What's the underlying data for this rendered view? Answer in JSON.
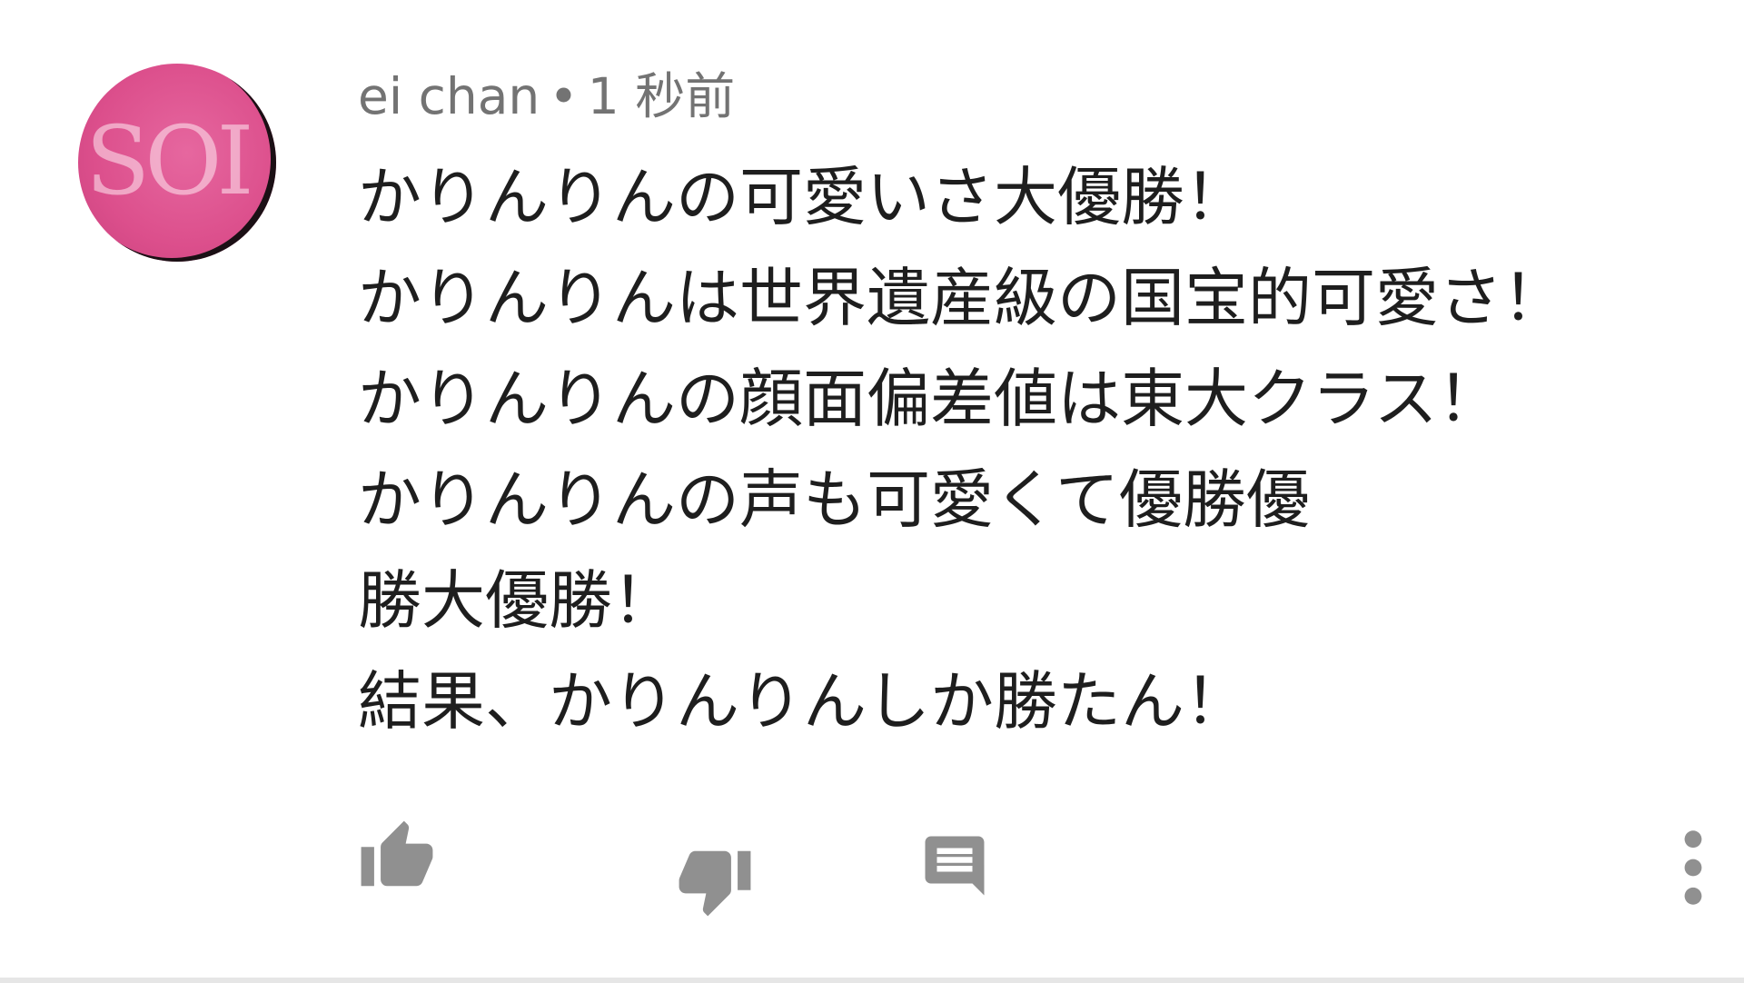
{
  "comment": {
    "author": "ei chan",
    "separator": "•",
    "time": "1 秒前",
    "avatar_text": "SOI",
    "lines": [
      "かりんりんの可愛いさ大優勝！",
      "かりんりんは世界遺産級の国宝的可愛さ！",
      "かりんりんの顔面偏差値は東大クラス！",
      "かりんりんの声も可愛くて優勝優",
      "勝大優勝！",
      "結果、かりんりんしか勝たん！"
    ]
  },
  "actions": {
    "icons": [
      "thumbs-up-icon",
      "thumbs-down-icon",
      "reply-icon",
      "more-vertical-icon"
    ],
    "icon_color": "#909090"
  },
  "colors": {
    "avatar_pink": "#dc4f8c",
    "meta_text": "#737373",
    "body_text": "#1e1e1e"
  }
}
